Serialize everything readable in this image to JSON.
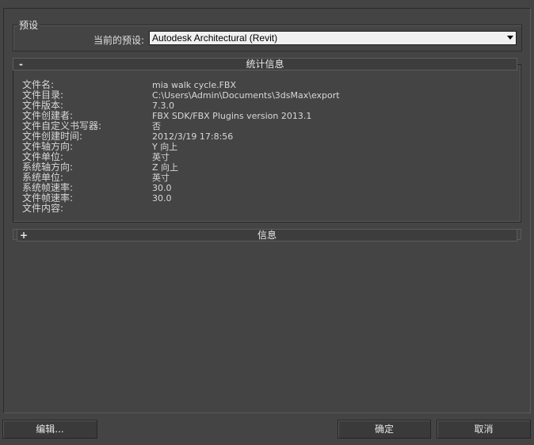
{
  "preset": {
    "group_title": "预设",
    "current_label": "当前的预设:",
    "selected_value": "Autodesk Architectural (Revit)"
  },
  "statistics": {
    "toggle_sign": "-",
    "title": "统计信息",
    "rows": [
      {
        "label": "文件名:",
        "value": "mia walk cycle.FBX"
      },
      {
        "label": "文件目录:",
        "value": "C:\\Users\\Admin\\Documents\\3dsMax\\export"
      },
      {
        "label": "文件版本:",
        "value": "7.3.0"
      },
      {
        "label": "文件创建者:",
        "value": "FBX SDK/FBX Plugins version 2013.1"
      },
      {
        "label": "文件自定义书写器:",
        "value": "否"
      },
      {
        "label": "文件创建时间:",
        "value": "2012/3/19  17:8:56"
      },
      {
        "label": "文件轴方向:",
        "value": "Y 向上"
      },
      {
        "label": "文件单位:",
        "value": "英寸"
      },
      {
        "label": "系统轴方向:",
        "value": "Z 向上"
      },
      {
        "label": "系统单位:",
        "value": "英寸"
      },
      {
        "label": "系统帧速率:",
        "value": "30.0"
      },
      {
        "label": "文件帧速率:",
        "value": "30.0"
      },
      {
        "label": "文件内容:",
        "value": ""
      }
    ]
  },
  "info": {
    "toggle_sign": "+",
    "title": "信息"
  },
  "buttons": {
    "edit": "编辑...",
    "ok": "确定",
    "cancel": "取消"
  }
}
